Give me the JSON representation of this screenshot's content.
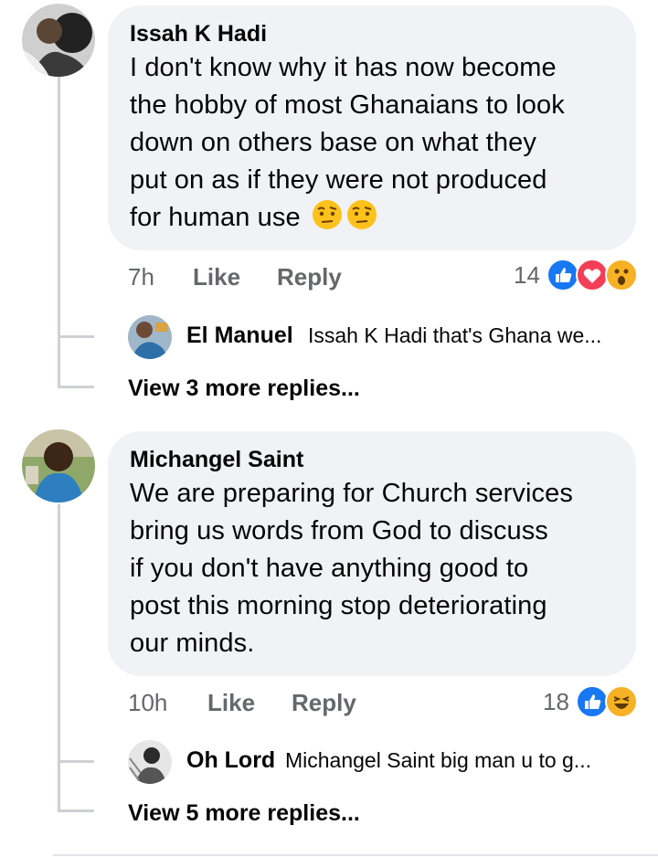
{
  "comments": [
    {
      "author": "Issah K Hadi",
      "lines": [
        "I don't know why it has now become",
        "the hobby of most Ghanaians to look",
        "down on others base on what they",
        "put on as if they were not produced",
        "for human use"
      ],
      "emojis": [
        "raised-eyebrow-emoji",
        "raised-eyebrow-emoji"
      ],
      "time": "7h",
      "like_label": "Like",
      "reply_label": "Reply",
      "reaction_count": "14",
      "reactions": [
        "like-reaction-icon",
        "love-reaction-icon",
        "wow-reaction-icon"
      ],
      "reply_preview": {
        "author": "El Manuel",
        "snippet": "Issah K Hadi that's Ghana we..."
      },
      "more_replies": "View 3 more replies..."
    },
    {
      "author": "Michangel Saint",
      "lines": [
        "We are preparing for Church services",
        "bring us words from God to discuss",
        "if you don't have anything good to",
        "post this morning stop deteriorating",
        "our minds."
      ],
      "time": "10h",
      "like_label": "Like",
      "reply_label": "Reply",
      "reaction_count": "18",
      "reactions": [
        "like-reaction-icon",
        "haha-reaction-icon"
      ],
      "reply_preview": {
        "author": "Oh Lord",
        "snippet": "Michangel Saint big man u to g..."
      },
      "more_replies": "View 5 more replies..."
    }
  ],
  "colors": {
    "bubble": "#f0f2f5",
    "meta": "#65676b",
    "like": "#1877f2",
    "love": "#f33e58",
    "wow": "#f7b125",
    "thread_line": "#ced0d4"
  }
}
